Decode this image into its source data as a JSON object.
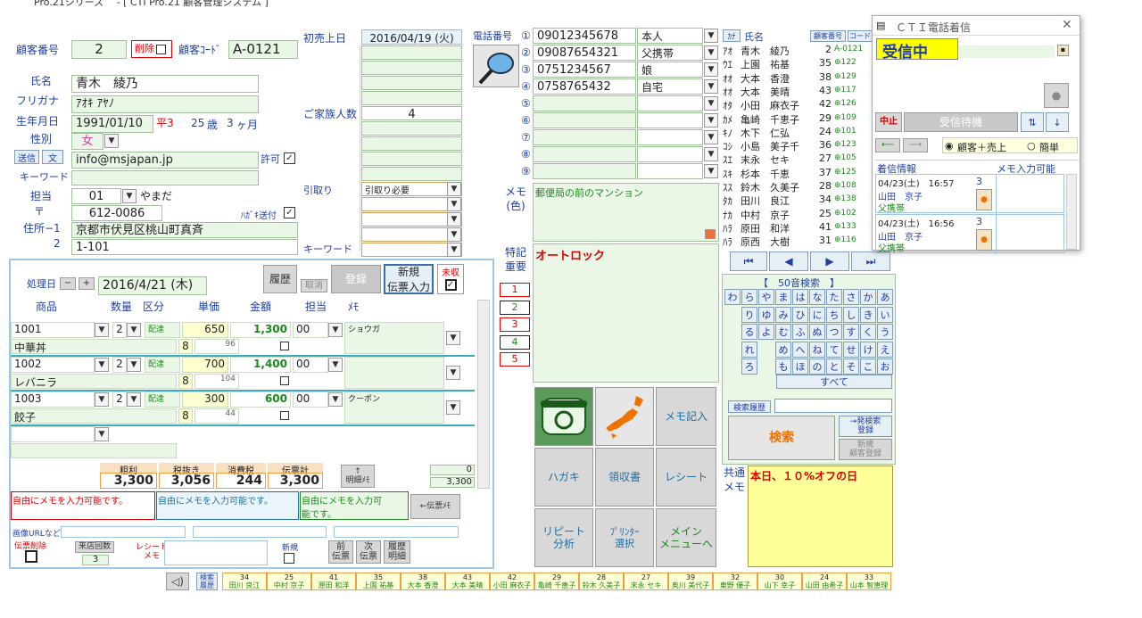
{
  "titlebar": {
    "text": "Pro.21シリーズ　 - [ CTI Pro.21 顧客管理システム ]"
  },
  "customer": {
    "no_label": "顧客番号",
    "no": "2",
    "delete_label": "削除",
    "code_label": "顧客ｺｰﾄﾞ",
    "code": "A-0121",
    "name_label": "氏名",
    "name": "青木　綾乃",
    "kana_label": "フリガナ",
    "kana": "ｱｵｷ ｱﾔﾉ",
    "birth_label": "生年月日",
    "birth": "1991/01/10",
    "era": "平3",
    "age": "25",
    "age_unit": "歳",
    "months": "3",
    "months_unit": "ヶ月",
    "sex_label": "性別",
    "sex": "女",
    "send_label": "送信",
    "mail_btn": "文",
    "email": "info@msjapan.jp",
    "permit_label": "許可",
    "keyword_label": "キーワード",
    "staff_label": "担当",
    "staff_code": "01",
    "staff_name": "やまだ",
    "zip_label": "〒",
    "zip": "612-0086",
    "postcard_label": "ﾊｶﾞｷ送付",
    "addr1_label": "住所−1",
    "addr1": "京都市伏見区桃山町真斉",
    "addr2_label": "2",
    "addr2": "1-101"
  },
  "sales": {
    "first_label": "初売上日",
    "first_date": "2016/04/19 (火)",
    "family_label": "ご家族人数",
    "family": "4",
    "pickup_label": "引取り",
    "pickup_value": "引取り必要",
    "keyword_label": "キーワード"
  },
  "phones": {
    "label": "電話番号",
    "rows": [
      {
        "num": "①",
        "tel": "09012345678",
        "rel": "本人"
      },
      {
        "num": "②",
        "tel": "09087654321",
        "rel": "父携帯"
      },
      {
        "num": "③",
        "tel": "0751234567",
        "rel": "娘"
      },
      {
        "num": "④",
        "tel": "0758765432",
        "rel": "自宅"
      },
      {
        "num": "⑤",
        "tel": "",
        "rel": ""
      },
      {
        "num": "⑥",
        "tel": "",
        "rel": ""
      },
      {
        "num": "⑦",
        "tel": "",
        "rel": ""
      },
      {
        "num": "⑧",
        "tel": "",
        "rel": ""
      },
      {
        "num": "⑨",
        "tel": "",
        "rel": ""
      }
    ]
  },
  "memo": {
    "label": "メモ\n(色)",
    "text": "郵便局の前のマンション",
    "special_label": "特記\n重要",
    "special_text": "オートロック"
  },
  "customer_list": {
    "kana_btn": "ｶﾅ",
    "name_header": "氏名",
    "no_btn": "顧客番号",
    "code_btn": "コード",
    "rows": [
      {
        "kana": "ｱｵ",
        "name": "青木　綾乃",
        "no": "2",
        "code": "A-0121"
      },
      {
        "kana": "ｳｴ",
        "name": "上園　祐基",
        "no": "35",
        "code": "⊕122"
      },
      {
        "kana": "ｵｵ",
        "name": "大本　香澄",
        "no": "38",
        "code": "⊕129"
      },
      {
        "kana": "ｵｵ",
        "name": "大本　美晴",
        "no": "43",
        "code": "⊕117"
      },
      {
        "kana": "ｵﾀ",
        "name": "小田　麻衣子",
        "no": "42",
        "code": "⊕126"
      },
      {
        "kana": "ｶﾒ",
        "name": "亀崎　千恵子",
        "no": "29",
        "code": "⊕109"
      },
      {
        "kana": "ｷﾉ",
        "name": "木下　仁弘",
        "no": "24",
        "code": "⊕101"
      },
      {
        "kana": "ｺｼ",
        "name": "小島　美子千",
        "no": "36",
        "code": "⊕123"
      },
      {
        "kana": "ｽｴ",
        "name": "末永　セキ",
        "no": "27",
        "code": "⊕105"
      },
      {
        "kana": "ｽｷ",
        "name": "杉本　千恵",
        "no": "37",
        "code": "⊕125"
      },
      {
        "kana": "ｽｽ",
        "name": "鈴木　久美子",
        "no": "28",
        "code": "⊕108"
      },
      {
        "kana": "ﾀｶ",
        "name": "田川　良江",
        "no": "34",
        "code": "⊕138"
      },
      {
        "kana": "ﾅｶ",
        "name": "中村　京子",
        "no": "25",
        "code": "⊕102"
      },
      {
        "kana": "ﾊﾗ",
        "name": "原田　和洋",
        "no": "41",
        "code": "⊕133"
      },
      {
        "kana": "ﾊﾗ",
        "name": "原西　大樹",
        "no": "31",
        "code": "⊕116"
      }
    ]
  },
  "nav": {
    "first": "⏮",
    "prev": "◀",
    "next": "▶",
    "last": "⏭"
  },
  "search50": {
    "title": "【　50音検索　】",
    "grid": [
      [
        "わ",
        "ら",
        "や",
        "ま",
        "は",
        "な",
        "た",
        "さ",
        "か",
        "あ"
      ],
      [
        "",
        "り",
        "ゆ",
        "み",
        "ひ",
        "に",
        "ち",
        "し",
        "き",
        "い"
      ],
      [
        "",
        "る",
        "よ",
        "む",
        "ふ",
        "ぬ",
        "つ",
        "す",
        "く",
        "う"
      ],
      [
        "",
        "れ",
        "",
        "め",
        "へ",
        "ね",
        "て",
        "せ",
        "け",
        "え"
      ],
      [
        "",
        "ろ",
        "",
        "も",
        "ほ",
        "の",
        "と",
        "そ",
        "こ",
        "お"
      ]
    ],
    "all": "すべて",
    "history": "検索履歴",
    "search": "検索",
    "quick": "→発検索\n登録",
    "new": "新規\n顧客登録"
  },
  "tiles": {
    "memo_entry": "メモ記入",
    "postcard": "ハガキ",
    "receipt": "領収書",
    "receipt2": "レシート",
    "repeat": "リピート\n分析",
    "printer": "ﾌﾟﾘﾝﾀｰ\n選択",
    "main": "メイン\nメニューへ"
  },
  "shared": {
    "label": "共通\nメモ",
    "text": "本日、１０%オフの日"
  },
  "order": {
    "date_label": "処理日",
    "date": "2016/4/21 (木)",
    "history_btn": "履歴",
    "cancel_btn": "取消",
    "register_btn": "登録",
    "new_slip": "新規\n伝票入力",
    "unpaid": "未収",
    "headers": {
      "item": "商品",
      "qty": "数量",
      "kubun": "区分",
      "price": "単価",
      "amount": "金額",
      "staff": "担当",
      "memo": "ﾒﾓ"
    },
    "lines": [
      {
        "code": "1001",
        "qty": "2",
        "kubun": "配達",
        "price": "650",
        "amount": "1,300",
        "staff": "00",
        "memo": "ショウガ",
        "name": "中華丼",
        "tax": "8",
        "tax_amt": "96"
      },
      {
        "code": "1002",
        "qty": "2",
        "kubun": "配達",
        "price": "700",
        "amount": "1,400",
        "staff": "00",
        "memo": "",
        "name": "レバニラ",
        "tax": "8",
        "tax_amt": "104"
      },
      {
        "code": "1003",
        "qty": "2",
        "kubun": "配達",
        "price": "300",
        "amount": "600",
        "staff": "00",
        "memo": "クーポン",
        "name": "餃子",
        "tax": "8",
        "tax_amt": "44"
      }
    ],
    "totals": {
      "profit_label": "粗利",
      "profit": "3,300",
      "ex_label": "税抜き",
      "ex": "3,056",
      "tax_label": "消費税",
      "tax": "244",
      "total_label": "伝票計",
      "total": "3,300",
      "detail_btn": "↑\n明細ﾒﾓ",
      "count": "0",
      "sum": "3,300"
    },
    "free_memos": [
      "自由にメモを入力可能です。",
      "自由にメモを入力可能です。",
      "自由にメモを入力可\n能です。"
    ],
    "slip_memo_btn": "←伝票ﾒﾓ",
    "image_url_label": "画像URLなど",
    "slip_delete": "伝票削除",
    "visits_label": "来店回数",
    "visits": "3",
    "receipt_memo": "レシート\nメモ",
    "new_label": "新規",
    "prev_slip": "前\n伝票",
    "next_slip": "次\n伝票",
    "hist_detail": "履歴\n明細"
  },
  "ranks": {
    "nos": [
      "1",
      "2",
      "3",
      "4",
      "5"
    ]
  },
  "bottom": {
    "history_btn": "検索\n履歴",
    "items": [
      {
        "no": "34",
        "name": "田川 良江"
      },
      {
        "no": "25",
        "name": "中村 京子"
      },
      {
        "no": "41",
        "name": "原田 和洋"
      },
      {
        "no": "35",
        "name": "上園 祐基"
      },
      {
        "no": "38",
        "name": "大本 香澄"
      },
      {
        "no": "43",
        "name": "大本 美晴"
      },
      {
        "no": "42",
        "name": "小田 麻衣子"
      },
      {
        "no": "29",
        "name": "亀崎 千恵子"
      },
      {
        "no": "28",
        "name": "鈴木 久美子"
      },
      {
        "no": "27",
        "name": "末永 セキ"
      },
      {
        "no": "39",
        "name": "奥川 美代子"
      },
      {
        "no": "32",
        "name": "東野 優子"
      },
      {
        "no": "30",
        "name": "山下 幸子"
      },
      {
        "no": "24",
        "name": "山田 由希子"
      },
      {
        "no": "33",
        "name": "山本 智恵理"
      }
    ]
  },
  "cti": {
    "title": "ＣＴＩ電話着信",
    "status": "受信中",
    "stop_btn": "中止",
    "wait_btn": "受信待機",
    "radio1": "顧客＋売上",
    "radio2": "簡単",
    "col1": "着信情報",
    "col2": "メモ入力可能",
    "calls": [
      {
        "date": "04/23(土)　16:57",
        "count": "3",
        "name": "山田　京子",
        "rel": "父携帯"
      },
      {
        "date": "04/23(土)　16:56",
        "count": "3",
        "name": "山田　京子",
        "rel": "父携帯"
      }
    ]
  }
}
